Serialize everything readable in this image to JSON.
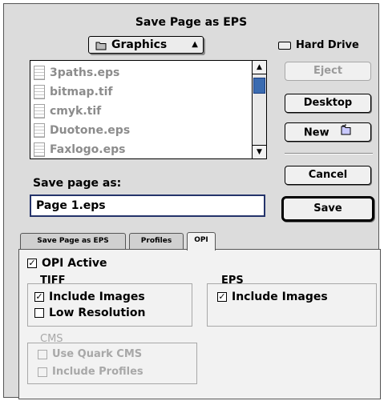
{
  "dialog": {
    "title": "Save Page as EPS",
    "folder_popup": {
      "label": "Graphics",
      "icon": "folder-icon"
    },
    "volume": {
      "label": "Hard Drive",
      "icon": "disk-icon"
    },
    "files": [
      {
        "name": "3paths.eps"
      },
      {
        "name": "bitmap.tif"
      },
      {
        "name": "cmyk.tif"
      },
      {
        "name": "Duotone.eps"
      },
      {
        "name": "Faxlogo.eps"
      }
    ],
    "buttons": {
      "eject": "Eject",
      "desktop": "Desktop",
      "new": "New",
      "cancel": "Cancel",
      "save": "Save"
    },
    "save_as": {
      "label": "Save page as:",
      "value": "Page 1.eps"
    }
  },
  "tabs": [
    {
      "label": "Save Page as EPS"
    },
    {
      "label": "Profiles"
    },
    {
      "label": "OPI",
      "active": true
    }
  ],
  "opi": {
    "opi_active": {
      "label": "OPI Active",
      "checked": true
    },
    "tiff": {
      "title": "TIFF",
      "include_images": {
        "label": "Include Images",
        "checked": true
      },
      "low_resolution": {
        "label": "Low Resolution",
        "checked": false
      }
    },
    "eps": {
      "title": "EPS",
      "include_images": {
        "label": "Include Images",
        "checked": true
      }
    },
    "cms": {
      "title": "CMS",
      "use_quark_cms": {
        "label": "Use Quark CMS",
        "checked": false,
        "disabled": true
      },
      "include_profiles": {
        "label": "Include Profiles",
        "checked": false,
        "disabled": true
      }
    }
  },
  "colors": {
    "selection": "#3a6bb0",
    "input_border": "#24336a"
  }
}
